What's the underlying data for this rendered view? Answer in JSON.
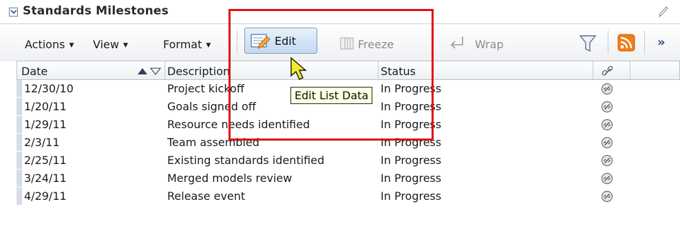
{
  "panel": {
    "title": "Standards Milestones"
  },
  "toolbar": {
    "actions_label": "Actions",
    "view_label": "View",
    "format_label": "Format",
    "edit_label": "Edit",
    "freeze_label": "Freeze",
    "wrap_label": "Wrap",
    "more_label": "»"
  },
  "table": {
    "columns": {
      "date": "Date",
      "description": "Description",
      "status": "Status"
    },
    "rows": [
      {
        "date": "12/30/10",
        "description": "Project kickoff",
        "status": "In Progress"
      },
      {
        "date": "1/20/11",
        "description": "Goals signed off",
        "status": "In Progress"
      },
      {
        "date": "1/29/11",
        "description": "Resource needs identified",
        "status": "In Progress"
      },
      {
        "date": "2/3/11",
        "description": "Team assembled",
        "status": "In Progress"
      },
      {
        "date": "2/25/11",
        "description": "Existing standards identified",
        "status": "In Progress"
      },
      {
        "date": "3/24/11",
        "description": "Merged models review",
        "status": "In Progress"
      },
      {
        "date": "4/29/11",
        "description": "Release event",
        "status": "In Progress"
      }
    ]
  },
  "tooltip": {
    "text": "Edit List Data"
  },
  "colors": {
    "highlight": "#e01010",
    "rss": "#f07d1a",
    "tooltip_bg": "#ffffe1"
  },
  "icons": [
    "chevron-down-icon",
    "pencil-icon",
    "edit-icon",
    "freeze-icon",
    "wrap-icon",
    "filter-icon",
    "rss-icon",
    "link-icon",
    "cursor-icon"
  ]
}
